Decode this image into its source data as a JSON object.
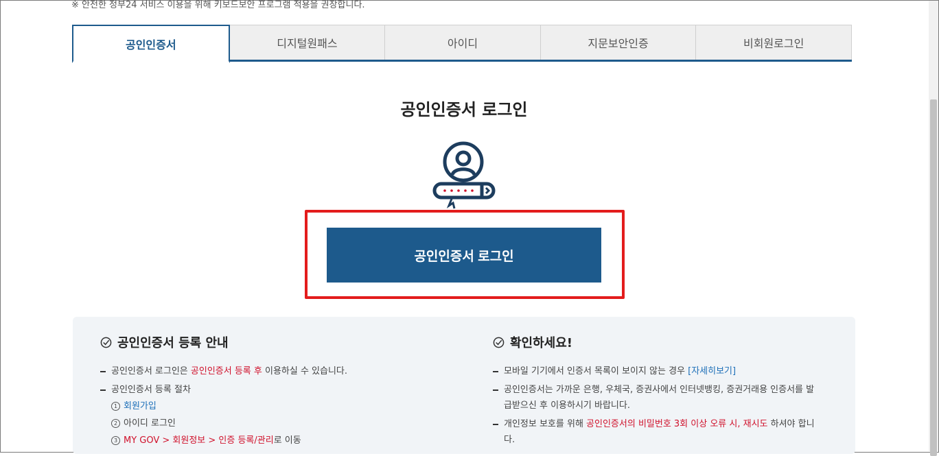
{
  "notice": "※ 안전한 정부24 서비스 이용을 위해 키보드보안 프로그램 적용을 권장합니다.",
  "tabs": [
    {
      "label": "공인인증서",
      "active": true
    },
    {
      "label": "디지털원패스",
      "active": false
    },
    {
      "label": "아이디",
      "active": false
    },
    {
      "label": "지문보안인증",
      "active": false
    },
    {
      "label": "비회원로그인",
      "active": false
    }
  ],
  "main": {
    "title": "공인인증서 로그인",
    "login_button": "공인인증서 로그인",
    "icon": "certificate-user-icon"
  },
  "info_left": {
    "heading": "공인인증서 등록 안내",
    "item1": {
      "pre": "공인인증서 로그인은 ",
      "highlight": "공인인증서 등록 후",
      "post": " 이용하실 수 있습니다."
    },
    "item2": "공인인증서 등록 절차",
    "steps": {
      "step1_num": "1",
      "step1": "회원가입",
      "step2_num": "2",
      "step2": "아이디 로그인",
      "step3_num": "3",
      "step3_highlight": "MY GOV > 회원정보 > 인증 등록/관리",
      "step3_post": "로 이동"
    }
  },
  "info_right": {
    "heading": "확인하세요!",
    "item1": {
      "pre": "모바일 기기에서 인증서 목록이 보이지 않는 경우 ",
      "link": "[자세히보기]"
    },
    "item2": "공인인증서는 가까운 은행, 우체국, 증권사에서 인터넷뱅킹, 증권거래용 인증서를 발급받으신 후 이용하시기 바랍니다.",
    "item3": {
      "pre": "개인정보 보호를 위해 ",
      "highlight": "공인인증서의 비밀번호 3회 이상 오류 시, 재시도",
      "post": " 하셔야 합니다."
    }
  },
  "colors": {
    "primary": "#1d5a8c",
    "highlight_box": "#e31c1c",
    "emphasis": "#d0112b",
    "link": "#1d6fb8"
  }
}
